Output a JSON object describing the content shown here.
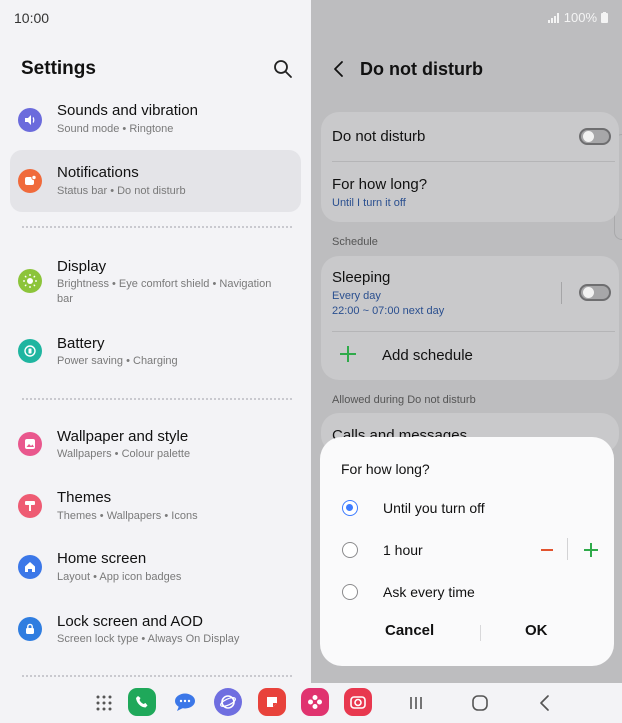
{
  "left": {
    "status_time": "10:00",
    "title": "Settings",
    "items": [
      {
        "title": "Sounds and vibration",
        "sub": "Sound mode  •  Ringtone",
        "icon": "volume-icon",
        "color": "#6b6bdc"
      },
      {
        "title": "Notifications",
        "sub": "Status bar  •  Do not disturb",
        "icon": "notification-icon",
        "color": "#f06a3b"
      },
      {
        "title": "Display",
        "sub": "Brightness  •  Eye comfort shield  •  Navigation bar",
        "icon": "sun-icon",
        "color": "#8cc43a"
      },
      {
        "title": "Battery",
        "sub": "Power saving  •  Charging",
        "icon": "battery-icon",
        "color": "#1fb5a0"
      },
      {
        "title": "Wallpaper and style",
        "sub": "Wallpapers  •  Colour palette",
        "icon": "wallpaper-icon",
        "color": "#e9578d"
      },
      {
        "title": "Themes",
        "sub": "Themes  •  Wallpapers  •  Icons",
        "icon": "themes-icon",
        "color": "#ee5b73"
      },
      {
        "title": "Home screen",
        "sub": "Layout  •  App icon badges",
        "icon": "home-icon",
        "color": "#3b77e8"
      },
      {
        "title": "Lock screen and AOD",
        "sub": "Screen lock type  •  Always On Display",
        "icon": "lock-icon",
        "color": "#2f7de0"
      }
    ]
  },
  "right": {
    "status_battery": "100%",
    "title": "Do not disturb",
    "dnd_label": "Do not disturb",
    "for_how_long_label": "For how long?",
    "for_how_long_value": "Until I turn it off",
    "schedule_section": "Schedule",
    "sleeping_title": "Sleeping",
    "sleeping_days": "Every day",
    "sleeping_time": "22:00 ~ 07:00 next day",
    "add_schedule": "Add schedule",
    "allowed_section": "Allowed during Do not disturb",
    "calls_messages": "Calls and messages"
  },
  "dialog": {
    "title": "For how long?",
    "options": [
      "Until you turn off",
      "1 hour",
      "Ask every time"
    ],
    "selected_index": 0,
    "cancel": "Cancel",
    "ok": "OK"
  },
  "colors": {
    "accent": "#3e7cff",
    "minus": "#e2532e",
    "plus": "#2faa4a",
    "link": "#2a4f8f"
  }
}
